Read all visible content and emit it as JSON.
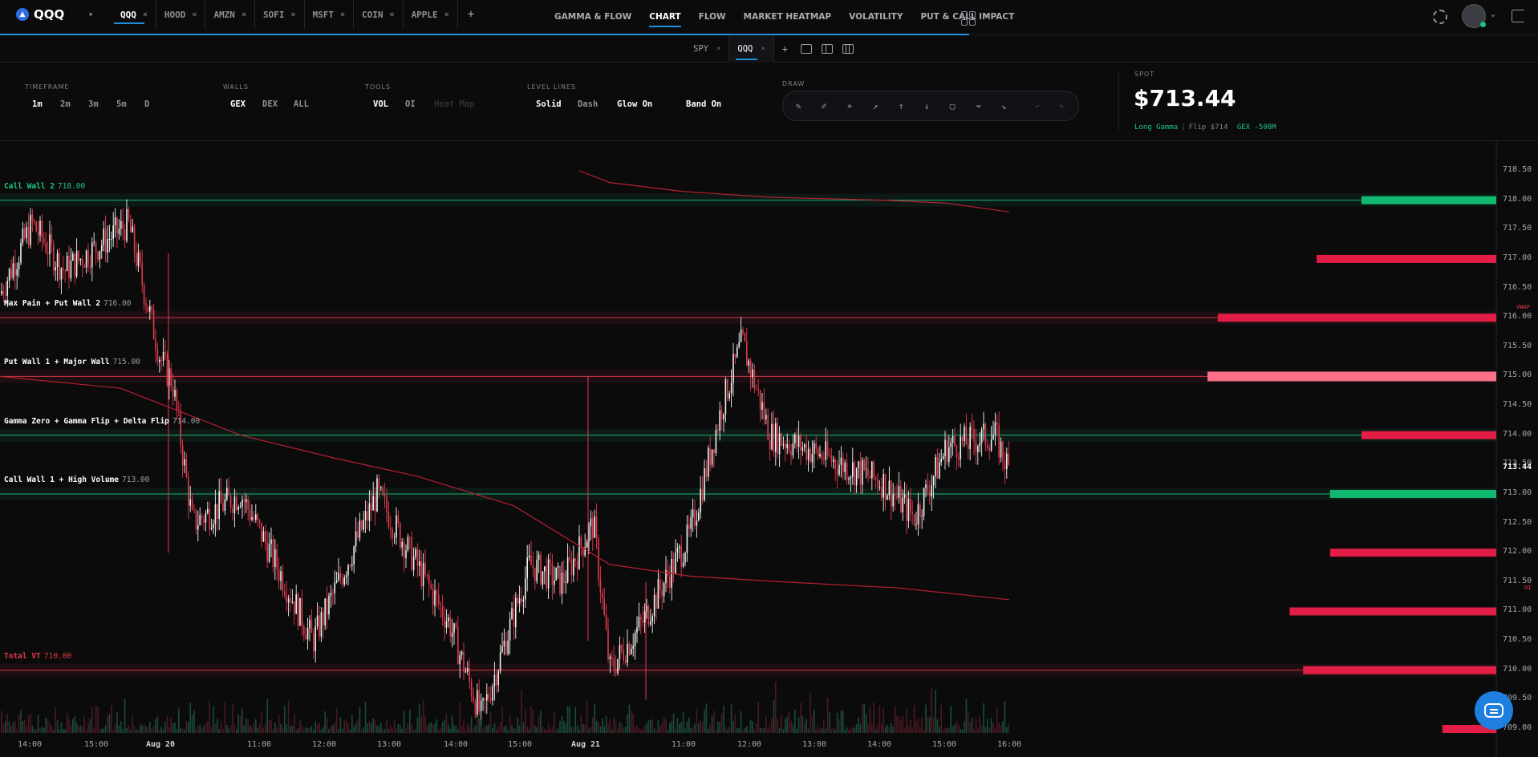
{
  "app": {
    "logo_text": "QQQ"
  },
  "tabs": [
    {
      "label": "QQQ",
      "close": "×",
      "active": true
    },
    {
      "label": "HOOD",
      "close": "×"
    },
    {
      "label": "AMZN",
      "close": "×"
    },
    {
      "label": "SOFI",
      "close": "×"
    },
    {
      "label": "MSFT",
      "close": "×"
    },
    {
      "label": "COIN",
      "close": "×"
    },
    {
      "label": "APPLE",
      "close": "×"
    }
  ],
  "tab_add": "+",
  "nav": [
    {
      "label": "GAMMA & FLOW"
    },
    {
      "label": "CHART",
      "active": true
    },
    {
      "label": "FLOW"
    },
    {
      "label": "MARKET HEATMAP"
    },
    {
      "label": "VOLATILITY"
    },
    {
      "label": "PUT & CALL IMPACT"
    }
  ],
  "subtabs": [
    {
      "label": "SPY",
      "close": "×"
    },
    {
      "label": "QQQ",
      "close": "×",
      "active": true
    }
  ],
  "subtab_add": "+",
  "toolbar": {
    "timeframe": {
      "label": "TIMEFRAME",
      "options": [
        "1m",
        "2m",
        "3m",
        "5m",
        "D"
      ],
      "selected": "1m"
    },
    "walls": {
      "label": "WALLS",
      "options": [
        "GEX",
        "DEX",
        "ALL"
      ],
      "selected": "GEX"
    },
    "tools": {
      "label": "TOOLS",
      "options": [
        "VOL",
        "OI",
        "Heat Map"
      ],
      "selected": "VOL"
    },
    "level_lines": {
      "label": "LEVEL LINES",
      "options": [
        "Solid",
        "Dash",
        "Glow On",
        "Band On"
      ],
      "selected": [
        "Solid",
        "Glow On",
        "Band On"
      ]
    },
    "draw": {
      "label": "DRAW"
    }
  },
  "spot": {
    "label": "SPOT",
    "price": "$713.44",
    "regime": "Long Gamma",
    "flip": "Flip $714",
    "gex": "GEX -500M"
  },
  "chart_data": {
    "type": "candlestick",
    "y_axis": {
      "ticks": [
        "718.50",
        "718.00",
        "717.50",
        "717.00",
        "716.50",
        "716.00",
        "715.50",
        "715.00",
        "714.50",
        "714.00",
        "713.50",
        "713.00",
        "712.50",
        "712.00",
        "711.50",
        "711.00",
        "710.50",
        "710.00",
        "709.50",
        "709.00"
      ],
      "range": [
        709.0,
        718.5
      ],
      "current": "713.44"
    },
    "x_axis": {
      "ticks": [
        {
          "label": "14:00"
        },
        {
          "label": "15:00"
        },
        {
          "label": "Aug 20",
          "bold": true
        },
        {
          "label": "11:00"
        },
        {
          "label": "12:00"
        },
        {
          "label": "13:00"
        },
        {
          "label": "14:00"
        },
        {
          "label": "15:00"
        },
        {
          "label": "Aug 21",
          "bold": true
        },
        {
          "label": "11:00"
        },
        {
          "label": "12:00"
        },
        {
          "label": "13:00"
        },
        {
          "label": "14:00"
        },
        {
          "label": "15:00"
        },
        {
          "label": "16:00"
        }
      ]
    },
    "levels": [
      {
        "name": "Call Wall 2",
        "value": "718.00",
        "color": "green"
      },
      {
        "name": "Max Pain + Put Wall 2",
        "value": "716.00",
        "color": "white"
      },
      {
        "name": "Put Wall 1 + Major Wall",
        "value": "715.00",
        "color": "white"
      },
      {
        "name": "Gamma Zero + Gamma Flip + Delta Flip",
        "value": "714.00",
        "color": "white"
      },
      {
        "name": "Call Wall 1 + High Volume",
        "value": "713.00",
        "color": "white"
      },
      {
        "name": "Total VT",
        "value": "710.00",
        "color": "red"
      }
    ],
    "gex_bars": [
      {
        "strike": 718,
        "magnitude": 0.3,
        "sign": "positive"
      },
      {
        "strike": 717,
        "magnitude": 0.4,
        "sign": "negative"
      },
      {
        "strike": 716,
        "magnitude": 0.62,
        "sign": "negative"
      },
      {
        "strike": 715,
        "magnitude": 0.64,
        "sign": "negative"
      },
      {
        "strike": 714,
        "magnitude": 0.3,
        "sign": "negative"
      },
      {
        "strike": 713,
        "magnitude": 0.37,
        "sign": "positive"
      },
      {
        "strike": 712,
        "magnitude": 0.37,
        "sign": "negative"
      },
      {
        "strike": 711,
        "magnitude": 0.46,
        "sign": "negative"
      },
      {
        "strike": 710,
        "magnitude": 0.43,
        "sign": "negative"
      },
      {
        "strike": 709,
        "magnitude": 0.12,
        "sign": "negative"
      }
    ],
    "side_tags": [
      "VWAP",
      "OI"
    ]
  },
  "colors": {
    "accent": "#1e8fd6",
    "green": "#1fc57d",
    "red": "#e2394b",
    "bg": "#0b0b0c"
  }
}
